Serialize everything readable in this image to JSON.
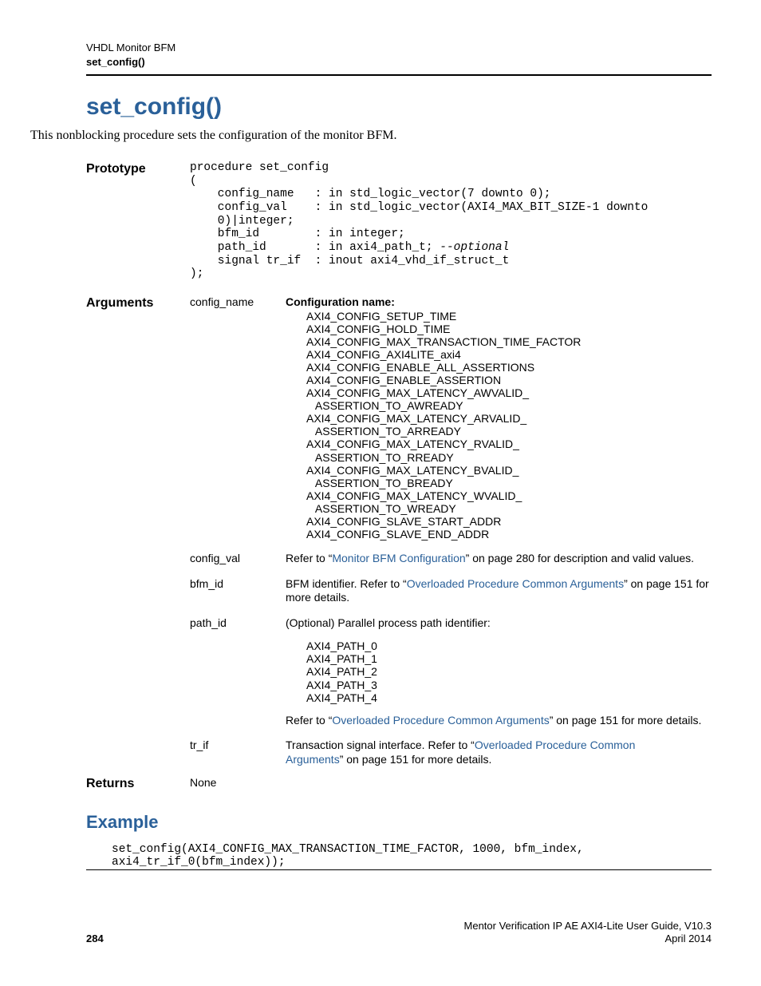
{
  "header": {
    "top": "VHDL Monitor BFM",
    "sub": "set_config()"
  },
  "title": "set_config()",
  "intro": "This nonblocking procedure sets the configuration of the monitor BFM.",
  "prototype_label": "Prototype",
  "prototype": {
    "l1": "procedure set_config",
    "l2": "(",
    "l3": "    config_name   : in std_logic_vector(7 downto 0);",
    "l4": "    config_val    : in std_logic_vector(AXI4_MAX_BIT_SIZE-1 downto",
    "l5": "    0)|integer;",
    "l6": "    bfm_id        : in integer;",
    "l7a": "    path_id       : in axi4_path_t; ",
    "l7b": "--optional",
    "l8": "    signal tr_if  : inout axi4_vhd_if_struct_t",
    "l9": ");"
  },
  "arguments_label": "Arguments",
  "args": {
    "config_name": {
      "name": "config_name",
      "heading": "Configuration name:",
      "values": "AXI4_CONFIG_SETUP_TIME\nAXI4_CONFIG_HOLD_TIME\nAXI4_CONFIG_MAX_TRANSACTION_TIME_FACTOR\nAXI4_CONFIG_AXI4LITE_axi4\nAXI4_CONFIG_ENABLE_ALL_ASSERTIONS\nAXI4_CONFIG_ENABLE_ASSERTION\nAXI4_CONFIG_MAX_LATENCY_AWVALID_\n   ASSERTION_TO_AWREADY\nAXI4_CONFIG_MAX_LATENCY_ARVALID_\n   ASSERTION_TO_ARREADY\nAXI4_CONFIG_MAX_LATENCY_RVALID_\n   ASSERTION_TO_RREADY\nAXI4_CONFIG_MAX_LATENCY_BVALID_\n   ASSERTION_TO_BREADY\nAXI4_CONFIG_MAX_LATENCY_WVALID_\n   ASSERTION_TO_WREADY\nAXI4_CONFIG_SLAVE_START_ADDR\nAXI4_CONFIG_SLAVE_END_ADDR"
    },
    "config_val": {
      "name": "config_val",
      "pre": "Refer to “",
      "link": "Monitor BFM Configuration",
      "post": "” on page 280 for description and valid values."
    },
    "bfm_id": {
      "name": "bfm_id",
      "pre": "BFM identifier. Refer to “",
      "link": "Overloaded Procedure Common Arguments",
      "post": "” on page 151 for more details."
    },
    "path_id": {
      "name": "path_id",
      "intro": "(Optional) Parallel process path identifier:",
      "values": "AXI4_PATH_0\nAXI4_PATH_1\nAXI4_PATH_2\nAXI4_PATH_3\nAXI4_PATH_4",
      "pre2": "Refer to “",
      "link2": "Overloaded Procedure Common Arguments",
      "post2": "” on page 151 for more details."
    },
    "tr_if": {
      "name": "tr_if",
      "pre": "Transaction signal interface. Refer to “",
      "link1": "Overloaded Procedure Common",
      "link2": "Arguments",
      "post": "” on page 151 for more details."
    }
  },
  "returns_label": "Returns",
  "returns_value": "None",
  "example_heading": "Example",
  "example_code": "set_config(AXI4_CONFIG_MAX_TRANSACTION_TIME_FACTOR, 1000, bfm_index,\naxi4_tr_if_0(bfm_index));",
  "footer": {
    "page": "284",
    "guide": "Mentor Verification IP AE AXI4-Lite User Guide, V10.3",
    "date": "April 2014"
  }
}
